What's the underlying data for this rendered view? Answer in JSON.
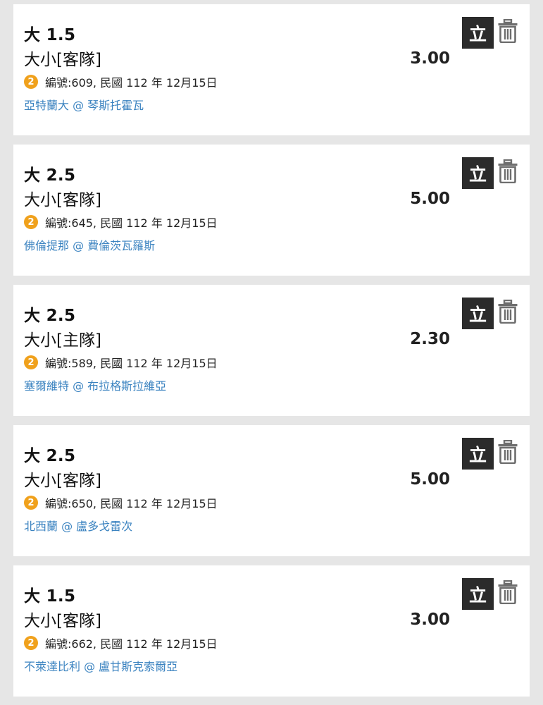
{
  "colors": {
    "background": "#e6e6e6",
    "card": "#ffffff",
    "badge": "#f0a11c",
    "team_link": "#3b83c0",
    "button_dark": "#2b2b2b",
    "trash_gray": "#6e6e6e"
  },
  "bets": [
    {
      "selection": "大 1.5",
      "market": "大小[客隊]",
      "odds": "3.00",
      "badge": "2",
      "game_info": "編號:609, 民國 112 年 12月15日",
      "teams": "亞特蘭大 @ 琴斯托霍瓦",
      "instant_label": "立",
      "delete_icon": "trash-icon"
    },
    {
      "selection": "大 2.5",
      "market": "大小[客隊]",
      "odds": "5.00",
      "badge": "2",
      "game_info": "編號:645, 民國 112 年 12月15日",
      "teams": "佛倫提那 @ 費倫茨瓦羅斯",
      "instant_label": "立",
      "delete_icon": "trash-icon"
    },
    {
      "selection": "大 2.5",
      "market": "大小[主隊]",
      "odds": "2.30",
      "badge": "2",
      "game_info": "編號:589, 民國 112 年 12月15日",
      "teams": "塞爾維特 @ 布拉格斯拉維亞",
      "instant_label": "立",
      "delete_icon": "trash-icon"
    },
    {
      "selection": "大 2.5",
      "market": "大小[客隊]",
      "odds": "5.00",
      "badge": "2",
      "game_info": "編號:650, 民國 112 年 12月15日",
      "teams": "北西蘭 @ 盧多戈雷次",
      "instant_label": "立",
      "delete_icon": "trash-icon"
    },
    {
      "selection": "大 1.5",
      "market": "大小[客隊]",
      "odds": "3.00",
      "badge": "2",
      "game_info": "編號:662, 民國 112 年 12月15日",
      "teams": "不萊達比利 @ 盧甘斯克索爾亞",
      "instant_label": "立",
      "delete_icon": "trash-icon"
    }
  ]
}
